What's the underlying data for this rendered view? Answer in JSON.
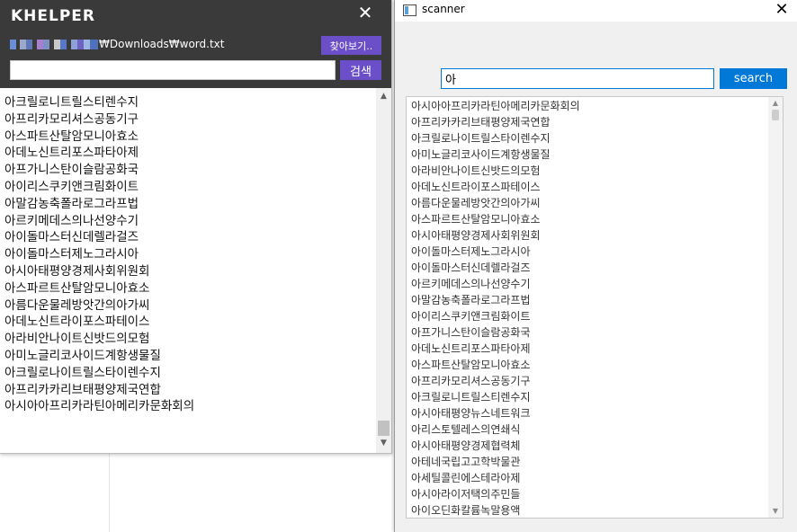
{
  "colors": {
    "khelper_header_bg": "#3a3a3a",
    "khelper_accent": "#6a4fc9",
    "scanner_accent": "#0078d7"
  },
  "khelper": {
    "title": "KHELPER",
    "close_glyph": "✕",
    "file_path_suffix": "₩Downloads₩word.txt",
    "browse_label": "찾아보기..",
    "search_value": "",
    "search_label": "검색",
    "words": [
      "아크릴로니트릴스티렌수지",
      "아프리카모리셔스공동기구",
      "아스파트산탈암모니아효소",
      "아데노신트리포스파타아제",
      "아프가니스탄이슬람공화국",
      "아이리스쿠키앤크림화이트",
      "아말감농축폴라로그라프법",
      "아르키메데스의나선양수기",
      "아이돌마스터신데렐라걸즈",
      "아이돌마스터제노그라시아",
      "아시아태평양경제사회위원회",
      "아스파르트산탈암모니아효소",
      "아름다운물레방앗간의아가씨",
      "아데노신트라이포스파테이스",
      "아라비안나이트신밧드의모험",
      "아미노글리코사이드계항생물질",
      "아크릴로나이트릴스타이렌수지",
      "아프리카카리브태평양제국연합",
      "아시아아프리카라틴아메리카문화회의"
    ],
    "scroll_up_glyph": "▲",
    "scroll_down_glyph": "▼"
  },
  "scanner": {
    "title": "scanner",
    "close_glyph": "✕",
    "search_value": "아",
    "search_label": "search",
    "results": [
      "아시아아프리카라틴아메리카문화회의",
      "아프리카카리브태평양제국연합",
      "아크릴로나이트릴스타이렌수지",
      "아미노글리코사이드계항생물질",
      "아라비안나이트신밧드의모험",
      "아데노신트라이포스파테이스",
      "아름다운물레방앗간의아가씨",
      "아스파르트산탈암모니아효소",
      "아시아태평양경제사회위원회",
      "아이돌마스터제노그라시아",
      "아이돌마스터신데렐라걸즈",
      "아르키메데스의나선양수기",
      "아말감농축폴라로그라프법",
      "아이리스쿠키앤크림화이트",
      "아프가니스탄이슬람공화국",
      "아데노신트리포스파타아제",
      "아스파트산탈암모니아효소",
      "아프리카모리셔스공동기구",
      "아크릴로니트릴스티렌수지",
      "아시아태평양뉴스네트워크",
      "아리스토텔레스의연쇄식",
      "아시아태평양경제협력체",
      "아테네국립고고학박물관",
      "아세틸콜린에스테라아제",
      "아시아라이저택의주민들",
      "아이오딘화칼륨녹말용액"
    ],
    "scroll_up_glyph": "▲",
    "scroll_down_glyph": "▼"
  }
}
